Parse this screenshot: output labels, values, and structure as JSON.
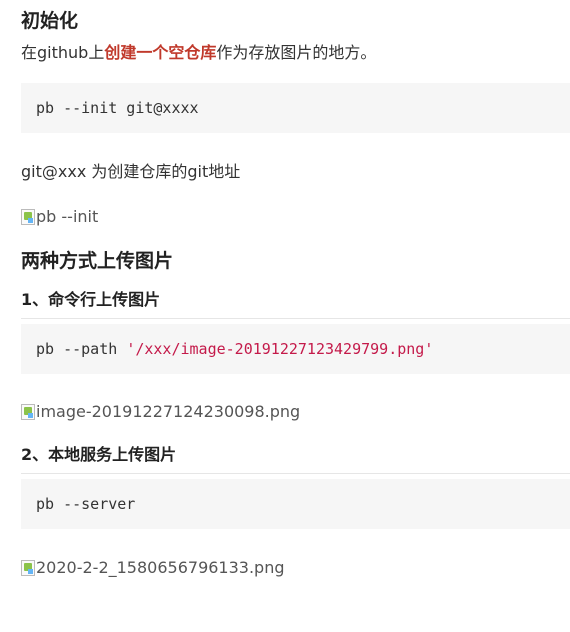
{
  "sections": {
    "init": {
      "title": "初始化",
      "desc_before": "在github上",
      "desc_link": "创建一个空仓库",
      "desc_after": "作为存放图片的地方。",
      "code_cmd": "pb --init git@xxxx",
      "note": "git@xxx 为创建仓库的git地址",
      "image_alt": "pb --init"
    },
    "upload": {
      "title": "两种方式上传图片",
      "cmdline": {
        "title": "1、命令行上传图片",
        "code_cmd": "pb --path ",
        "code_str": "'/xxx/image-20191227123429799.png'",
        "image_alt": "image-20191227124230098.png"
      },
      "server": {
        "title": "2、本地服务上传图片",
        "code_cmd": "pb --server",
        "image_alt": "2020-2-2_1580656796133.png"
      }
    }
  }
}
